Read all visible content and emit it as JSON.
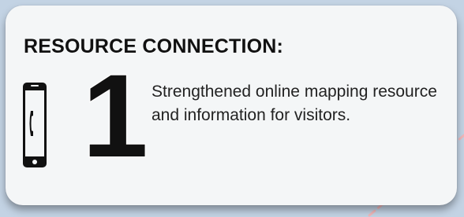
{
  "card": {
    "heading": "RESOURCE CONNECTION:",
    "number": "1",
    "description": "Strengthened online mapping resource and information for visitors."
  },
  "icons": {
    "phone": "mobile-phone-icon",
    "decoration": "dashed-route-line"
  },
  "colors": {
    "background": "#c3d3e4",
    "card": "#f4f6f7",
    "text": "#111111",
    "dashes": "#f0b8bb"
  }
}
